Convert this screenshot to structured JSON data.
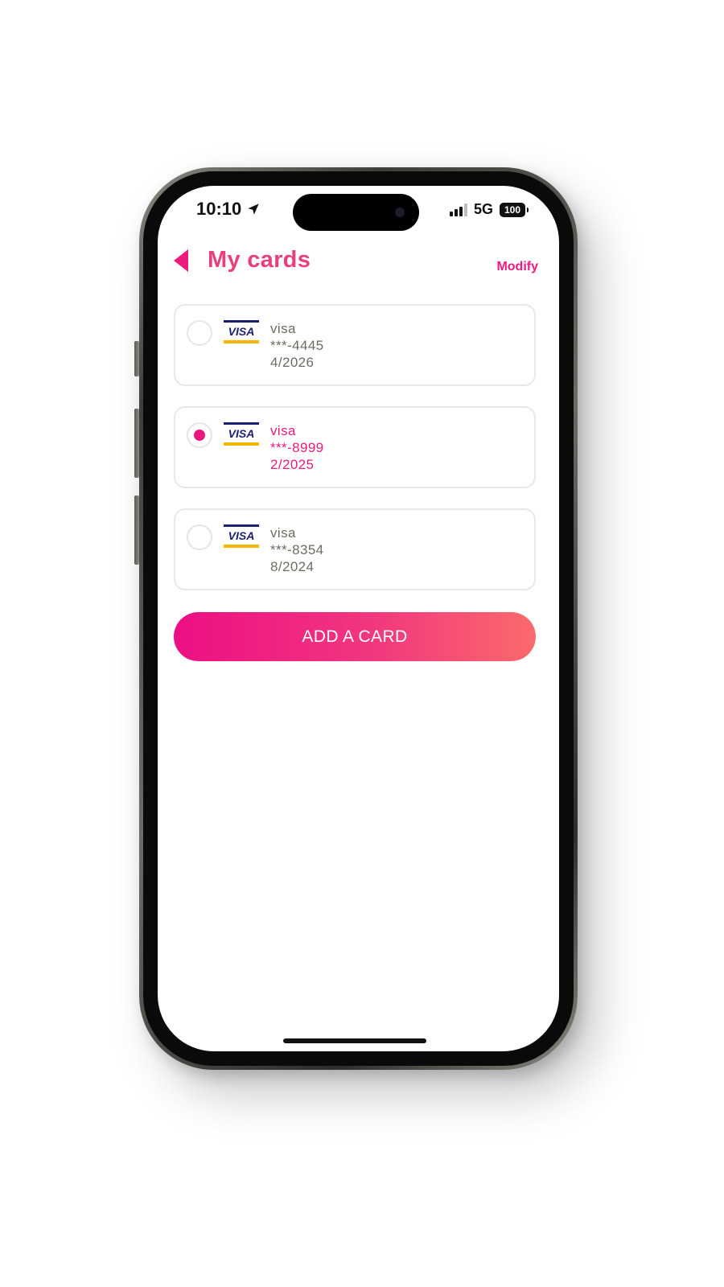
{
  "status_bar": {
    "time": "10:10",
    "network": "5G",
    "battery": "100",
    "location_icon": "location-arrow-icon",
    "signal_icon": "signal-bars-icon"
  },
  "header": {
    "back_icon": "back-triangle-icon",
    "title": "My cards",
    "modify_label": "Modify"
  },
  "cards": [
    {
      "brand": "visa",
      "number": "***-4445",
      "expiry": "4/2026",
      "selected": false
    },
    {
      "brand": "visa",
      "number": "***-8999",
      "expiry": "2/2025",
      "selected": true
    },
    {
      "brand": "visa",
      "number": "***-8354",
      "expiry": "8/2024",
      "selected": false
    }
  ],
  "add_card_label": "ADD A CARD",
  "colors": {
    "accent": "#ea1a7f",
    "title": "#ea3f7f",
    "gradient_start": "#ec0f84",
    "gradient_end": "#fb6a6c",
    "card_text": "#6f6b63",
    "visa_blue": "#1a1f71",
    "visa_gold": "#f7b600"
  }
}
